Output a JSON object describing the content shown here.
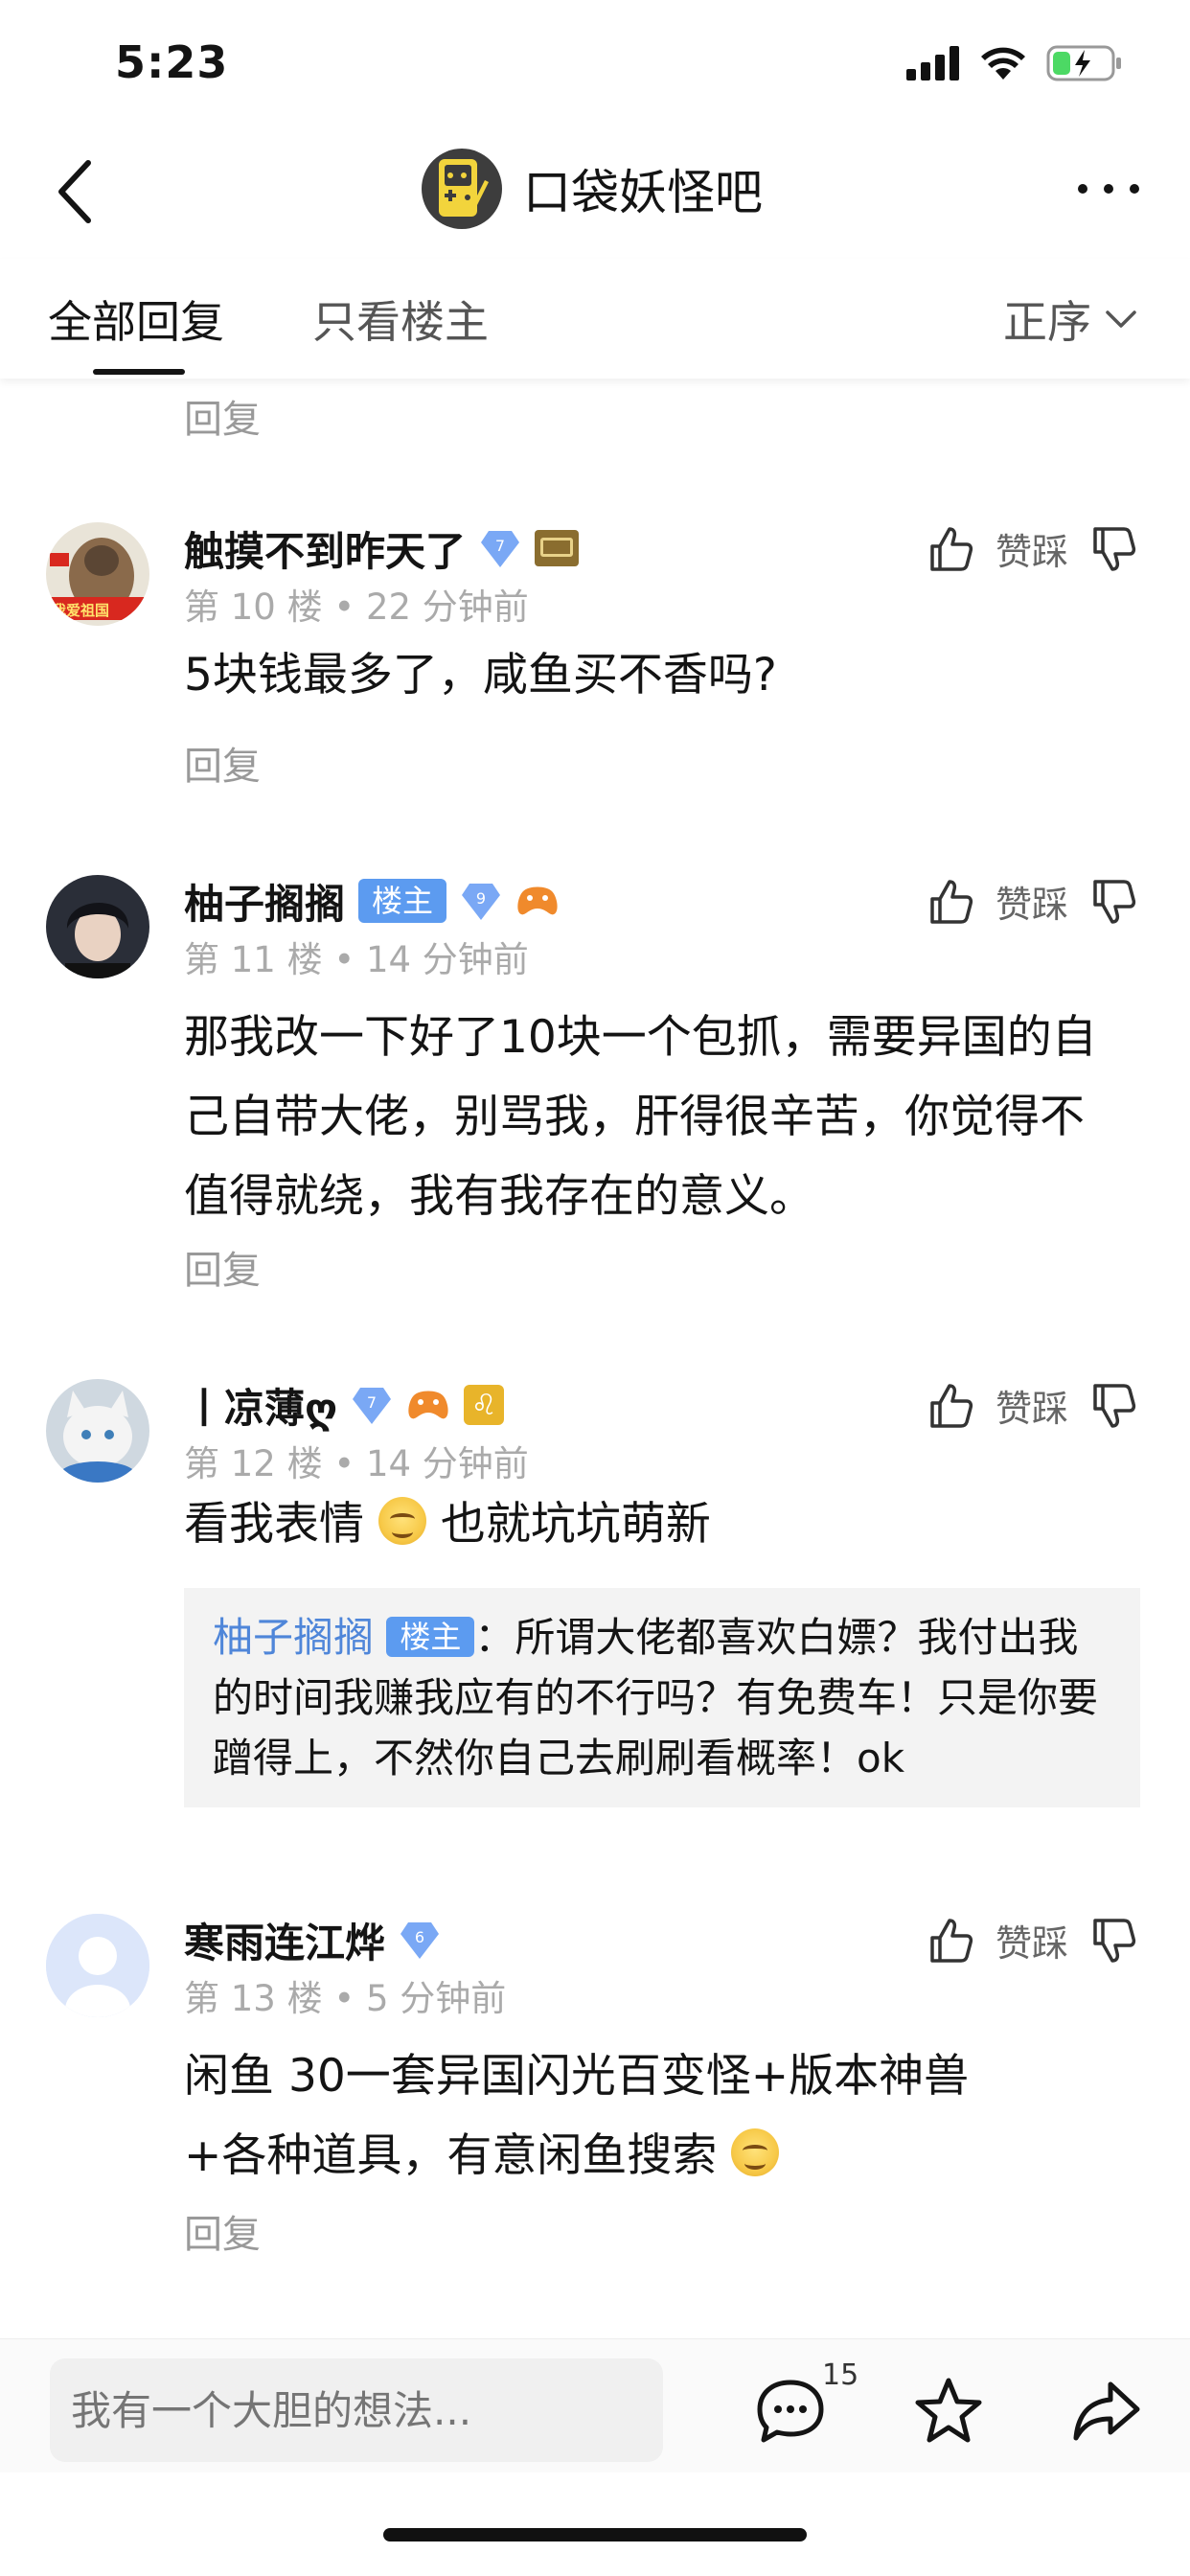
{
  "status": {
    "time": "5:23"
  },
  "nav": {
    "title": "口袋妖怪吧"
  },
  "tabs": {
    "all": "全部回复",
    "owner_only": "只看楼主",
    "sort": "正序"
  },
  "top_reply": "回复",
  "posts": [
    {
      "name": "触摸不到昨天了",
      "level": "7",
      "avatar_text": "我爱祖国",
      "meta": "第 10 楼 • 22 分钟前",
      "body": "5块钱最多了，咸鱼买不香吗?",
      "reply": "回复",
      "like_label": "赞踩"
    },
    {
      "name": "柚子搁搁",
      "owner_tag": "楼主",
      "level": "9",
      "meta": "第 11 楼 • 14 分钟前",
      "body": "那我改一下好了10块一个包抓，需要异国的自己自带大佬，别骂我，肝得很辛苦，你觉得不值得就绕，我有我存在的意义。",
      "reply": "回复",
      "like_label": "赞踩"
    },
    {
      "name": "丨凉薄ღ",
      "level": "7",
      "meta": "第 12 楼 • 14 分钟前",
      "body_a": "看我表情",
      "body_b": "也就坑坑萌新",
      "quote_name": "柚子搁搁",
      "quote_tag": "楼主",
      "quote_text": "：所谓大佬都喜欢白嫖？我付出我的时间我赚我应有的不行吗？有免费车！只是你要蹭得上，不然你自己去刷刷看概率！ok",
      "like_label": "赞踩"
    },
    {
      "name": "寒雨连江烨",
      "level": "6",
      "meta": "第 13 楼 • 5 分钟前",
      "body_a": "闲鱼 30一套异国闪光百变怪+版本神兽",
      "body_b": "+各种道具，有意闲鱼搜索",
      "reply": "回复",
      "like_label": "赞踩"
    }
  ],
  "bottom": {
    "placeholder": "我有一个大胆的想法...",
    "comment_count": "15"
  },
  "colors": {
    "accent_blue": "#5c9bf0",
    "link_blue": "#4f86d9",
    "gray_text": "#999999"
  }
}
